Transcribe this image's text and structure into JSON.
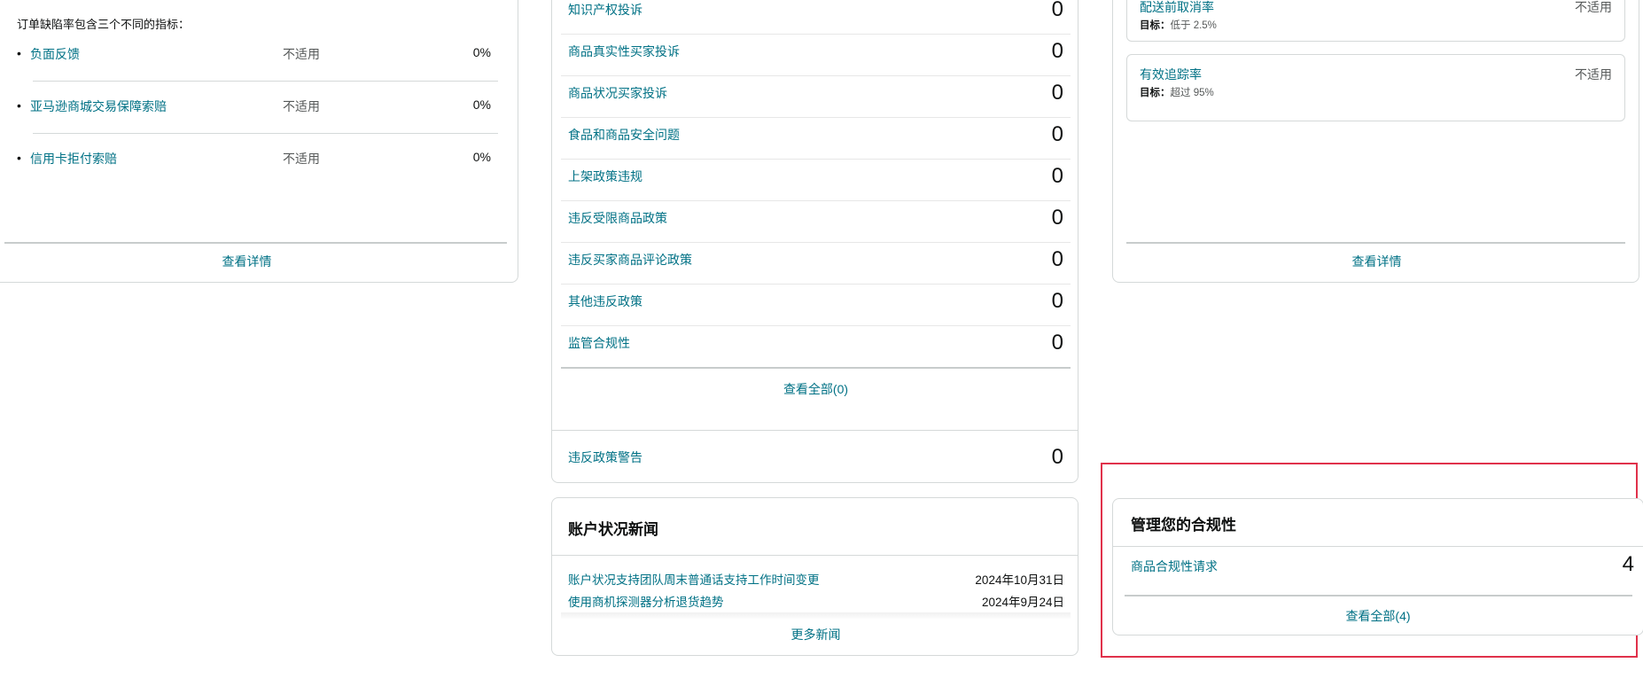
{
  "order_defect": {
    "intro": "订单缺陷率包含三个不同的指标：",
    "metrics": [
      {
        "name": "负面反馈",
        "status": "不适用",
        "value": "0%"
      },
      {
        "name": "亚马逊商城交易保障索赔",
        "status": "不适用",
        "value": "0%"
      },
      {
        "name": "信用卡拒付索赔",
        "status": "不适用",
        "value": "0%"
      }
    ],
    "view_details": "查看详情"
  },
  "policy": {
    "rows": [
      {
        "name": "知识产权投诉",
        "value": "0"
      },
      {
        "name": "商品真实性买家投诉",
        "value": "0"
      },
      {
        "name": "商品状况买家投诉",
        "value": "0"
      },
      {
        "name": "食品和商品安全问题",
        "value": "0"
      },
      {
        "name": "上架政策违规",
        "value": "0"
      },
      {
        "name": "违反受限商品政策",
        "value": "0"
      },
      {
        "name": "违反买家商品评论政策",
        "value": "0"
      },
      {
        "name": "其他违反政策",
        "value": "0"
      },
      {
        "name": "监管合规性",
        "value": "0"
      }
    ],
    "view_all": "查看全部(0)",
    "warning": {
      "name": "违反政策警告",
      "value": "0"
    }
  },
  "news": {
    "title": "账户状况新闻",
    "items": [
      {
        "title": "账户状况支持团队周末普通话支持工作时间变更",
        "date": "2024年10月31日"
      },
      {
        "title": "使用商机探测器分析退货趋势",
        "date": "2024年9月24日"
      }
    ],
    "more": "更多新闻"
  },
  "shipping": {
    "metrics": [
      {
        "name": "配送前取消率",
        "target_label": "目标：",
        "target": "低于 2.5%",
        "status": "不适用"
      },
      {
        "name": "有效追踪率",
        "target_label": "目标：",
        "target": "超过 95%",
        "status": "不适用"
      }
    ],
    "view_details": "查看详情"
  },
  "compliance": {
    "title": "管理您的合规性",
    "row": {
      "name": "商品合规性请求",
      "value": "4"
    },
    "view_all": "查看全部(4)",
    "highlight_color": "#e0314b"
  }
}
